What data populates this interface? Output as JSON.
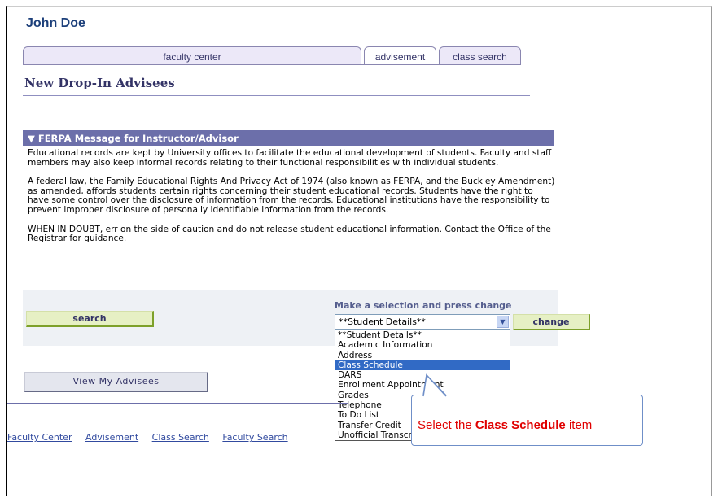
{
  "header": {
    "user_name": "John Doe"
  },
  "tabs": [
    {
      "label": "faculty center"
    },
    {
      "label": "advisement",
      "active": true
    },
    {
      "label": "class search"
    }
  ],
  "page": {
    "title": "New Drop-In Advisees"
  },
  "ferpa": {
    "header": "▼ FERPA Message for Instructor/Advisor",
    "paragraphs": [
      "Educational records are kept by University offices to facilitate the educational development of students. Faculty and staff members may also keep informal records relating to their functional responsibilities with individual students.",
      "A federal law, the Family Educational Rights And Privacy Act of 1974 (also known as FERPA, and the Buckley Amendment) as amended, affords students certain rights concerning their student educational records. Students have the right to have some control over the disclosure of information from the records. Educational institutions have the responsibility to prevent improper disclosure of personally identifiable information from the records.",
      "WHEN IN DOUBT, err on the side of caution and do not release student educational information. Contact the Office of the Registrar for guidance."
    ]
  },
  "controls": {
    "search_label": "search",
    "select_label": "Make a selection and press change",
    "select_value": "**Student Details**",
    "change_label": "change",
    "view_advisees_label": "View My Advisees"
  },
  "dropdown": {
    "selected_index": 3,
    "options": [
      "**Student Details**",
      "Academic Information",
      "Address",
      "Class Schedule",
      "DARS",
      "Enrollment Appointment",
      "Grades",
      "Telephone",
      "To Do List",
      "Transfer Credit",
      "Unofficial Transcript"
    ]
  },
  "footer": {
    "links": [
      "Faculty Center",
      "Advisement",
      "Class Search",
      "Faculty Search"
    ]
  },
  "callout": {
    "prefix": "Select the ",
    "bold": "Class Schedule",
    "suffix": " item"
  },
  "colors": {
    "header_bar": "#6c6faa",
    "selection": "#316ac5",
    "callout_text": "#e00000"
  }
}
